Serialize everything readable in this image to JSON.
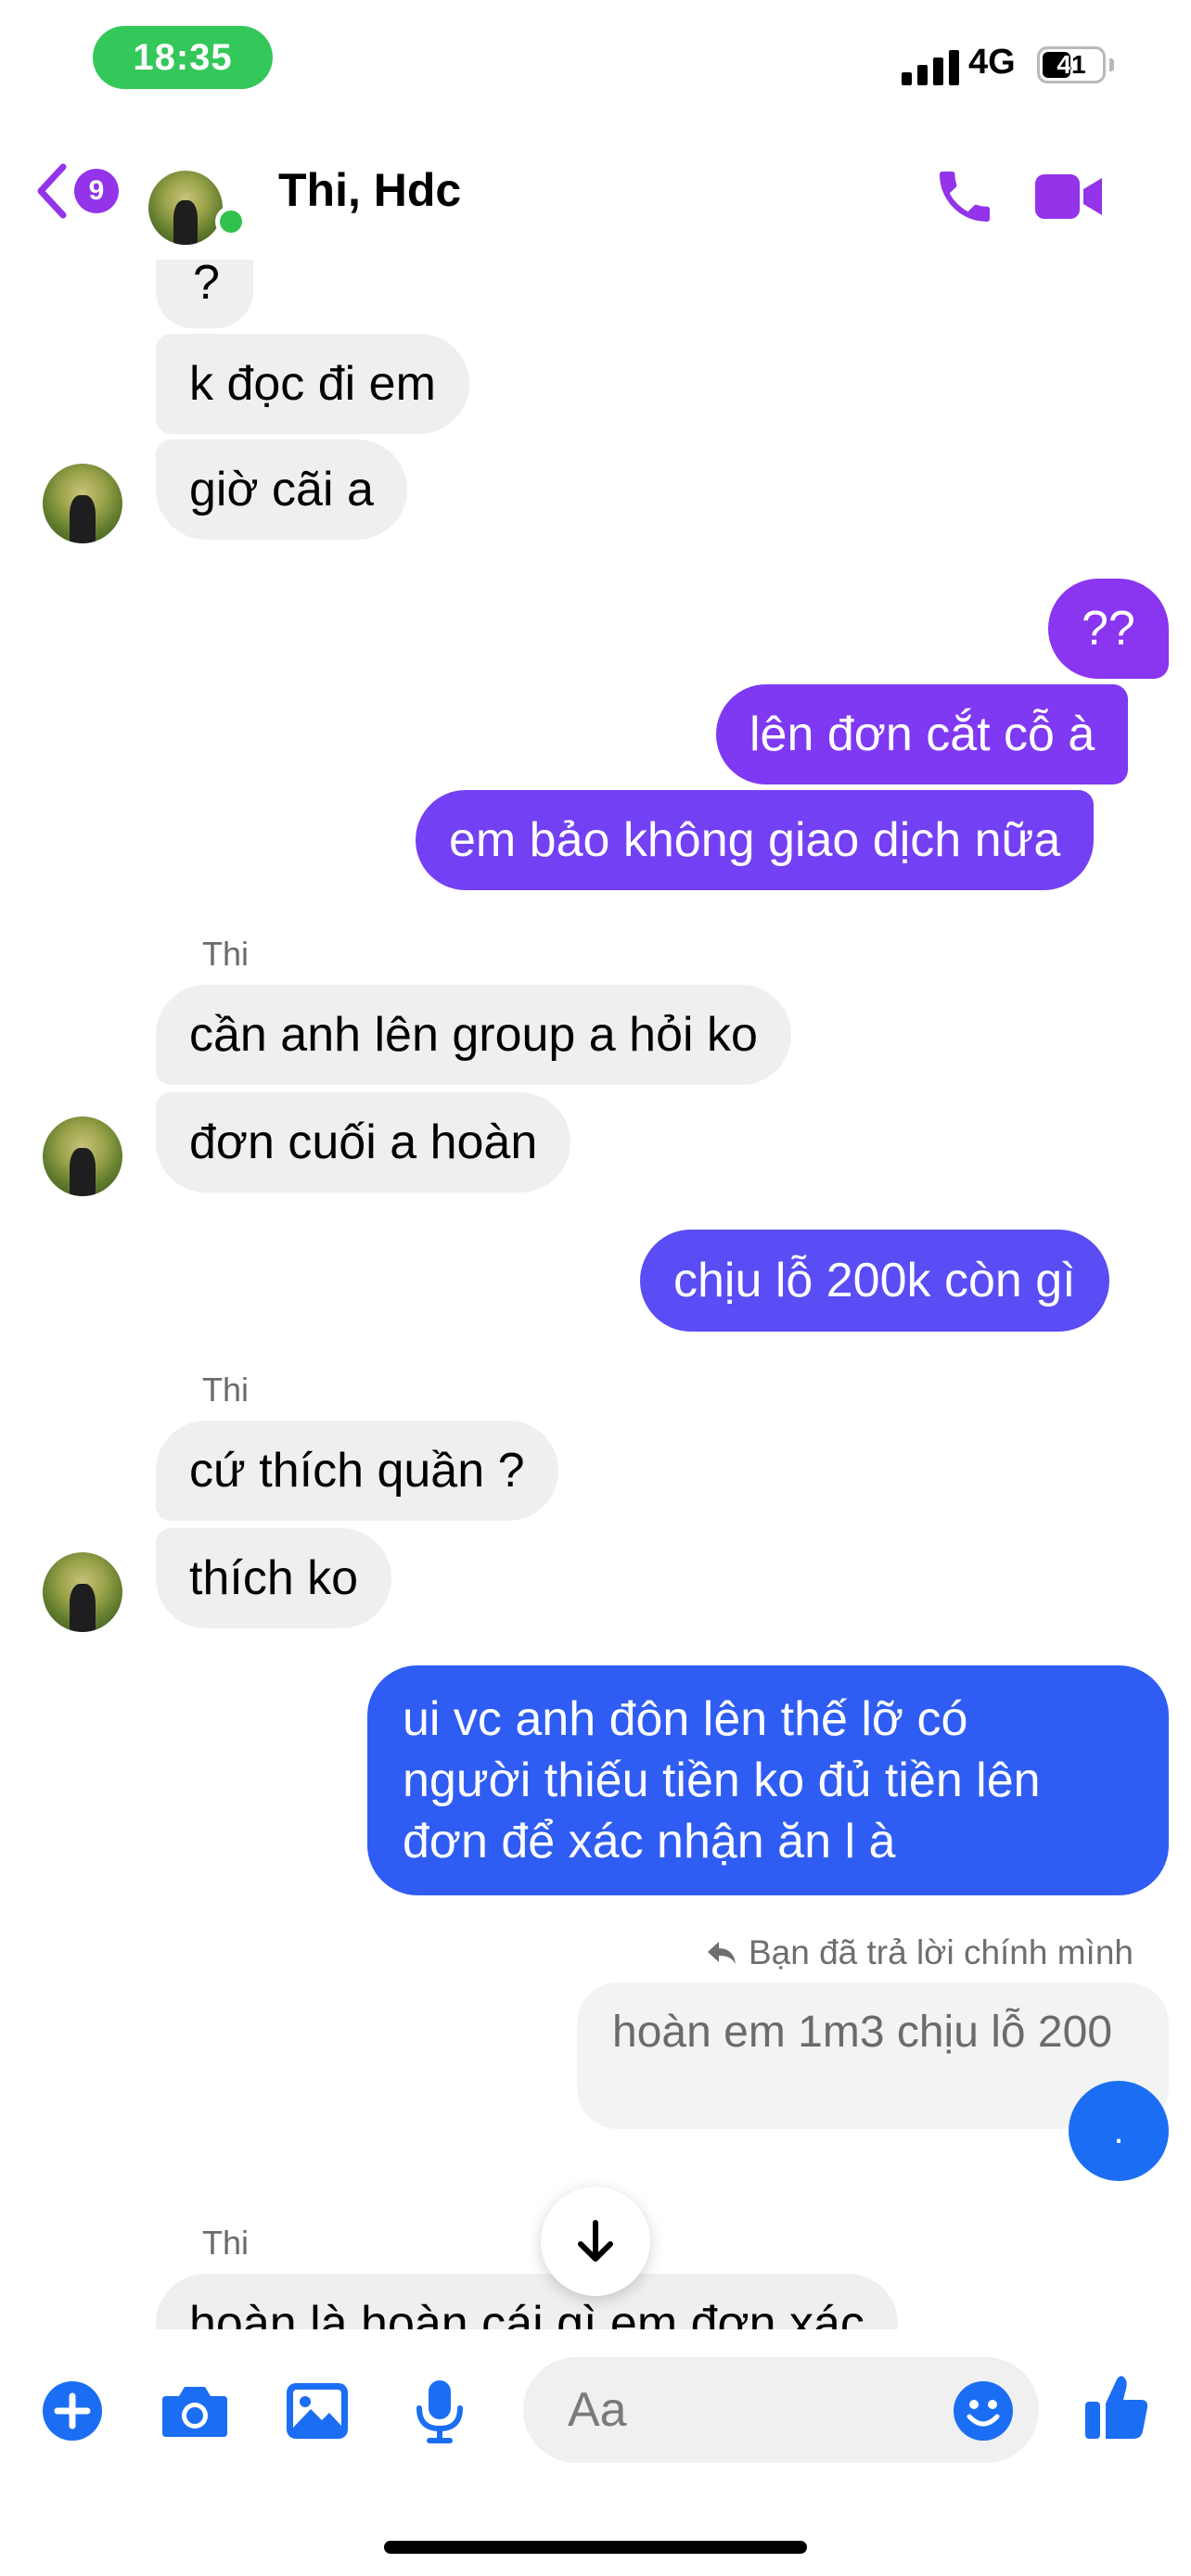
{
  "status_bar": {
    "time": "18:35",
    "network": "4G",
    "battery": "41"
  },
  "header": {
    "back_count": "9",
    "title": "Thi, Hdc"
  },
  "messages": {
    "m1": "?",
    "m2": "k đọc đi em",
    "m3": "giờ cãi a",
    "m4": "??",
    "m5": "lên đơn cắt cỗ à",
    "m6": "em bảo không giao dịch nữa",
    "sender1": "Thi",
    "m7": "cần anh lên group a hỏi ko",
    "m8": "đơn cuối a hoàn",
    "m9": "chịu lỗ 200k còn gì",
    "sender2": "Thi",
    "m10": "cứ thích quần ?",
    "m11": "thích ko",
    "m12_l1": "ui vc anh đôn lên thế lỡ có",
    "m12_l2": "người thiếu tiền ko đủ tiền lên",
    "m12_l3": "đơn để xác nhận ăn l à",
    "reply_note": "Bạn đã trả lời chính mình",
    "reply_quote": "hoàn em 1m3 chịu lỗ 200",
    "m13": ".",
    "sender3": "Thi",
    "m14": "hoàn là hoàn cái gì em đơn xác"
  },
  "composer": {
    "placeholder": "Aa"
  },
  "colors": {
    "accent": "#9333ea",
    "out_purple": "#7a3df5",
    "out_blue": "#2f5df3",
    "incoming": "#efefef"
  },
  "icons": [
    "chevron-left-icon",
    "phone-icon",
    "video-icon",
    "plus-icon",
    "camera-icon",
    "image-icon",
    "microphone-icon",
    "emoji-icon",
    "thumbs-up-icon",
    "arrow-down-icon",
    "reply-icon"
  ]
}
